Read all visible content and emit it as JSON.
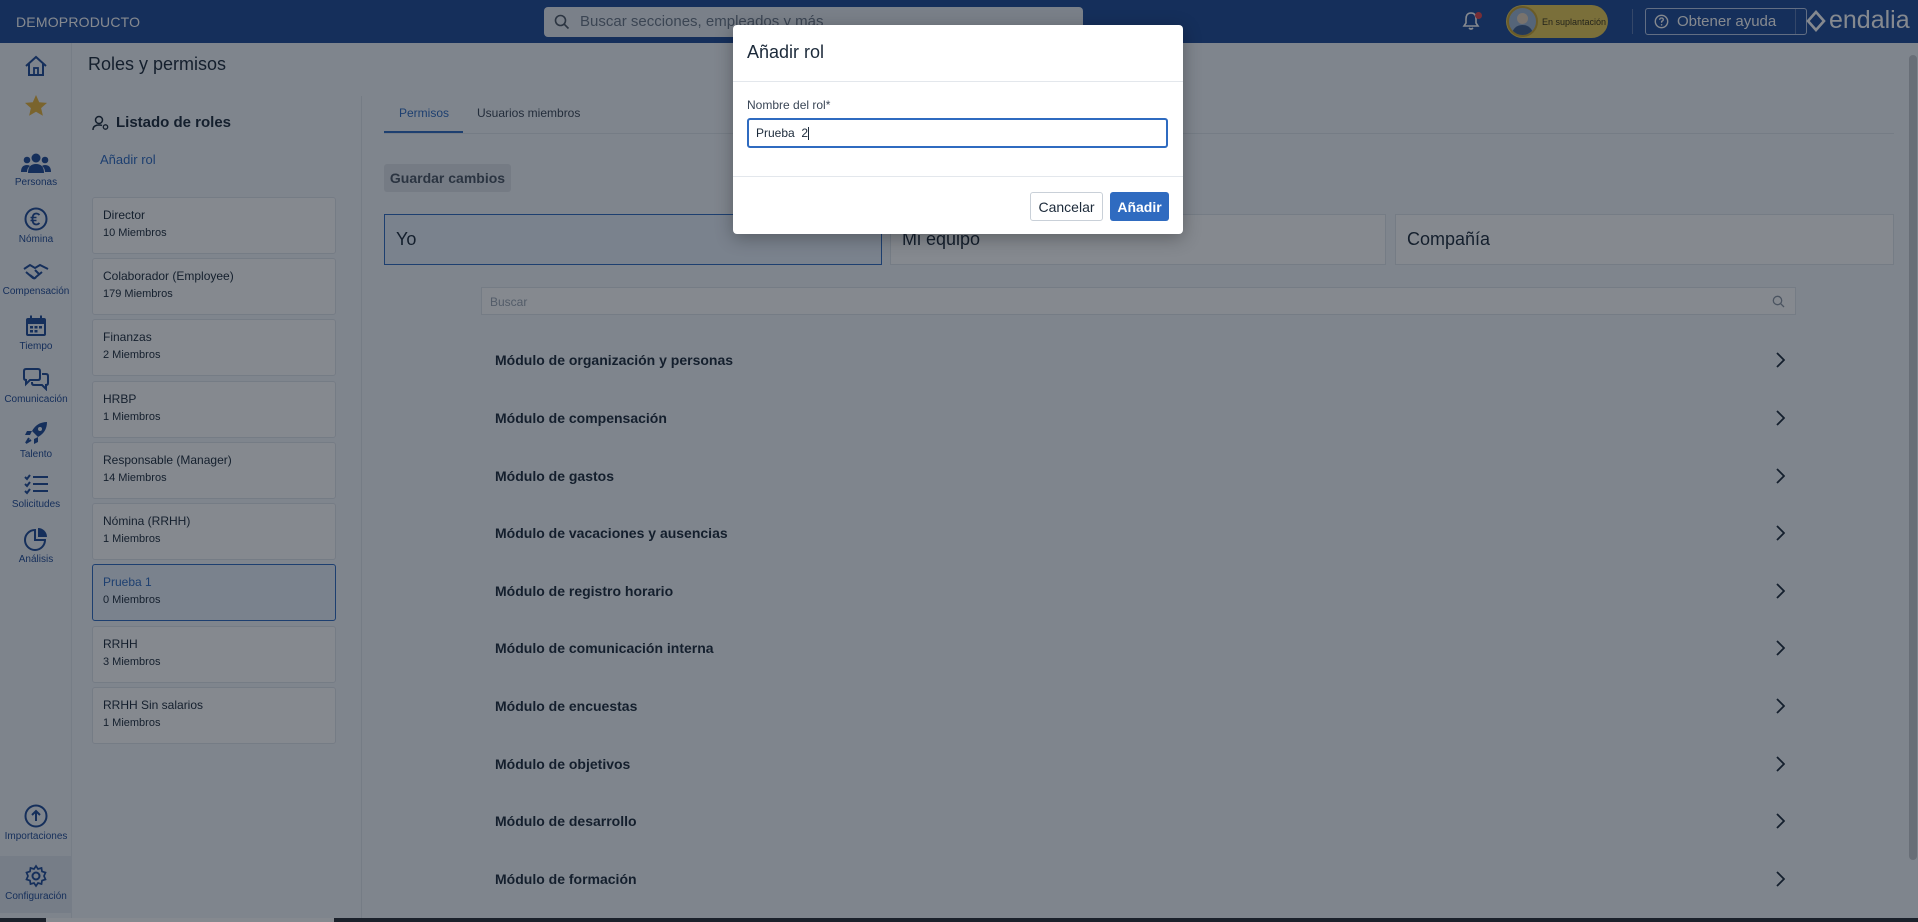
{
  "topbar": {
    "brand": "DEMOPRODUCTO",
    "search_placeholder": "Buscar secciones, empleados y más",
    "impersonation_label": "En suplantación",
    "help_label": "Obtener ayuda",
    "logo_text": "endalia"
  },
  "leftnav": {
    "items": [
      {
        "label": "",
        "icon": "home-icon"
      },
      {
        "label": "",
        "icon": "star-icon"
      },
      {
        "label": "Personas",
        "icon": "people-icon"
      },
      {
        "label": "Nómina",
        "icon": "euro-icon"
      },
      {
        "label": "Compensación",
        "icon": "handshake-icon"
      },
      {
        "label": "Tiempo",
        "icon": "calendar-icon"
      },
      {
        "label": "Comunicación",
        "icon": "chat-icon"
      },
      {
        "label": "Talento",
        "icon": "rocket-icon"
      },
      {
        "label": "Solicitudes",
        "icon": "checklist-icon"
      },
      {
        "label": "Análisis",
        "icon": "pie-chart-icon"
      },
      {
        "label": "Importaciones",
        "icon": "upload-icon"
      },
      {
        "label": "Configuración",
        "icon": "gear-icon"
      }
    ]
  },
  "page": {
    "title": "Roles y permisos"
  },
  "roles": {
    "header": "Listado de roles",
    "add_label": "Añadir rol",
    "items": [
      {
        "name": "Director",
        "members": "10 Miembros",
        "active": false
      },
      {
        "name": "Colaborador (Employee)",
        "members": "179 Miembros",
        "active": false
      },
      {
        "name": "Finanzas",
        "members": "2 Miembros",
        "active": false
      },
      {
        "name": "HRBP",
        "members": "1 Miembros",
        "active": false
      },
      {
        "name": "Responsable (Manager)",
        "members": "14 Miembros",
        "active": false
      },
      {
        "name": "Nómina (RRHH)",
        "members": "1 Miembros",
        "active": false
      },
      {
        "name": "Prueba 1",
        "members": "0 Miembros",
        "active": true
      },
      {
        "name": "RRHH",
        "members": "3 Miembros",
        "active": false
      },
      {
        "name": "RRHH Sin salarios",
        "members": "1 Miembros",
        "active": false
      }
    ]
  },
  "tabs": [
    {
      "label": "Permisos",
      "active": true
    },
    {
      "label": "Usuarios miembros",
      "active": false
    }
  ],
  "save_label": "Guardar cambios",
  "scopes": [
    {
      "label": "Yo",
      "active": true
    },
    {
      "label": "Mi equipo",
      "active": false
    },
    {
      "label": "Compañía",
      "active": false
    }
  ],
  "module_search_placeholder": "Buscar",
  "modules": [
    "Módulo de organización y personas",
    "Módulo de compensación",
    "Módulo de gastos",
    "Módulo de vacaciones y ausencias",
    "Módulo de registro horario",
    "Módulo de comunicación interna",
    "Módulo de encuestas",
    "Módulo de objetivos",
    "Módulo de desarrollo",
    "Módulo de formación"
  ],
  "modal": {
    "title": "Añadir rol",
    "field_label": "Nombre del rol*",
    "field_value": "Prueba  2",
    "cancel_label": "Cancelar",
    "add_label": "Añadir"
  },
  "colors": {
    "primary": "#1f4a96",
    "accent": "#2f6bc0",
    "impersonation": "#e8ca55",
    "background": "#f3f6fa"
  }
}
